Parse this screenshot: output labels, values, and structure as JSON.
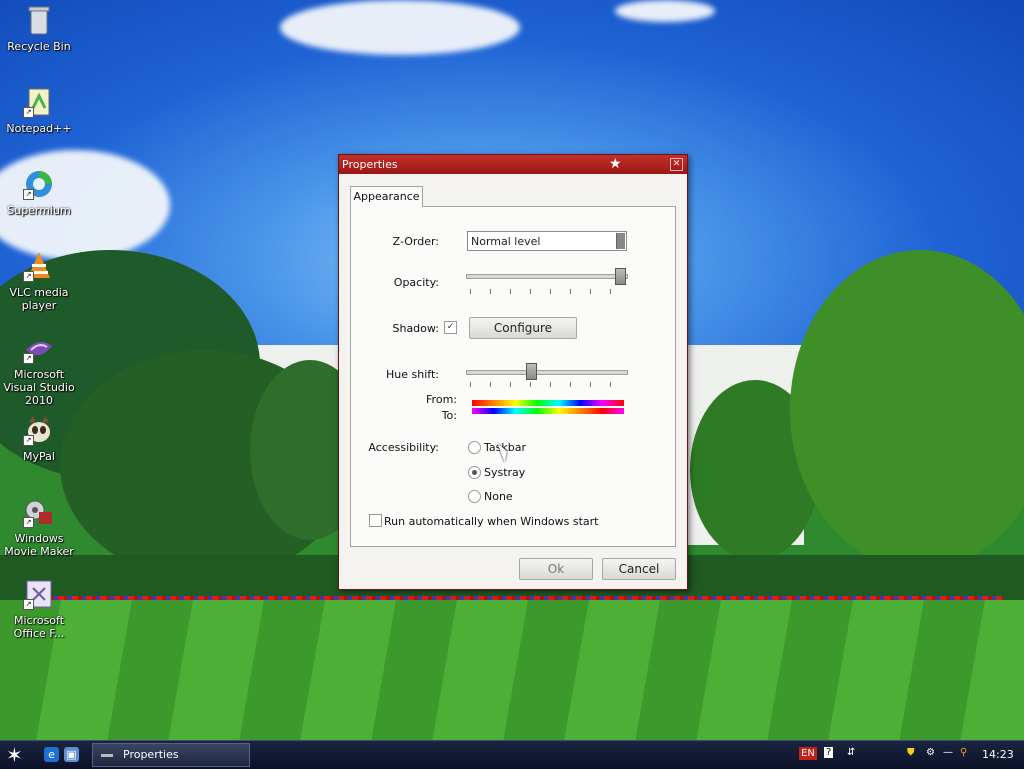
{
  "desktop": {
    "icons": [
      {
        "label": "Recycle Bin",
        "icon": "recycle-bin-icon"
      },
      {
        "label": "Notepad++",
        "icon": "notepad-plus-plus-icon"
      },
      {
        "label": "Supermium",
        "icon": "supermium-icon"
      },
      {
        "label": "VLC media player",
        "icon": "vlc-icon"
      },
      {
        "label": "Microsoft Visual Studio 2010",
        "icon": "visual-studio-icon"
      },
      {
        "label": "MyPal",
        "icon": "mypal-icon"
      },
      {
        "label": "Windows Movie Maker",
        "icon": "movie-maker-icon"
      },
      {
        "label": "Microsoft Office F...",
        "icon": "office-icon"
      }
    ]
  },
  "dialog": {
    "title": "Properties",
    "tab": "Appearance",
    "z_order": {
      "label": "Z-Order:",
      "value": "Normal level"
    },
    "opacity": {
      "label": "Opacity:",
      "level": 1.0
    },
    "shadow": {
      "label": "Shadow:",
      "checked": true,
      "configure_label": "Configure"
    },
    "hue_shift": {
      "label": "Hue shift:",
      "level": 0.4
    },
    "from_label": "From:",
    "to_label": "To:",
    "accessibility": {
      "label": "Accessibility:",
      "options": [
        "Taskbar",
        "Systray",
        "None"
      ],
      "selected": "Systray"
    },
    "run_automatically": {
      "label": "Run automatically when Windows start",
      "checked": false
    },
    "ok_label": "Ok",
    "cancel_label": "Cancel"
  },
  "taskbar": {
    "window_button": "Properties",
    "language": "EN",
    "clock": "14:23"
  }
}
